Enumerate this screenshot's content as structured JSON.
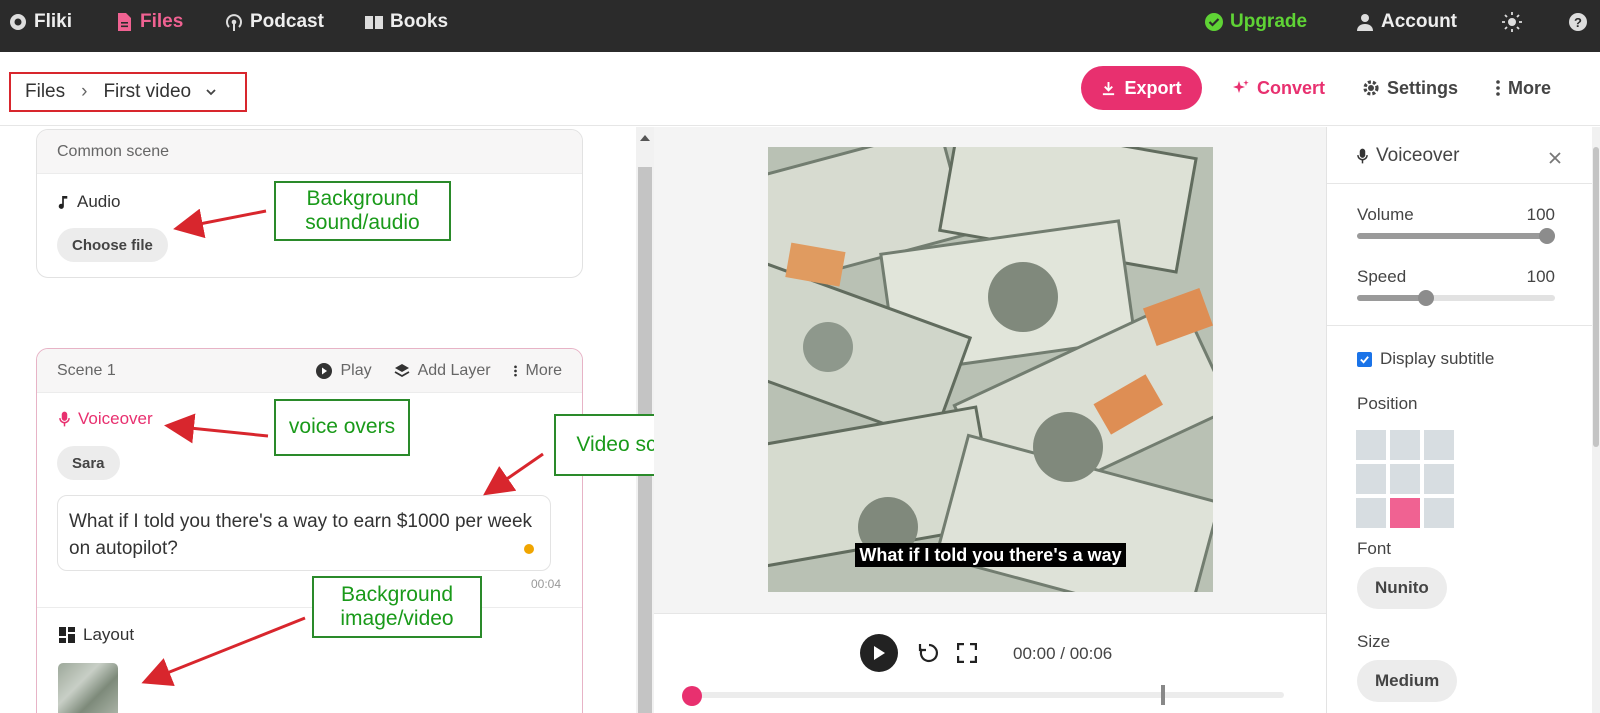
{
  "topnav": {
    "brand": "Fliki",
    "files": "Files",
    "podcast": "Podcast",
    "books": "Books",
    "upgrade": "Upgrade",
    "account": "Account"
  },
  "breadcrumb": {
    "root": "Files",
    "sep": "›",
    "current": "First video"
  },
  "toolbar": {
    "export": "Export",
    "convert": "Convert",
    "settings": "Settings",
    "more": "More"
  },
  "common_scene": {
    "title": "Common scene",
    "audio_label": "Audio",
    "choose_file": "Choose file"
  },
  "scene1": {
    "title": "Scene 1",
    "play": "Play",
    "add_layer": "Add Layer",
    "more": "More",
    "voiceover_label": "Voiceover",
    "voice": "Sara",
    "script": "What if I told you there's a way to earn $1000 per week on autopilot?",
    "duration": "00:04",
    "layout_label": "Layout"
  },
  "annotations": {
    "bg_audio": "Background sound/audio",
    "voice_overs": "voice overs",
    "video_script": "Video script",
    "bg_image": "Background image/video"
  },
  "preview": {
    "subtitle": "What if I told you there's a way",
    "time": "00:00 / 00:06"
  },
  "panel": {
    "title": "Voiceover",
    "volume_label": "Volume",
    "volume_value": "100",
    "volume_level": 1.0,
    "speed_label": "Speed",
    "speed_value": "100",
    "speed_level": 0.35,
    "display_subtitle": "Display subtitle",
    "position_label": "Position",
    "font_label": "Font",
    "font_value": "Nunito",
    "size_label": "Size",
    "size_value": "Medium"
  },
  "colors": {
    "accent": "#e8306f",
    "upgrade": "#5fd335",
    "annotation": "#1a9a1a",
    "arrow": "#d8262d"
  }
}
